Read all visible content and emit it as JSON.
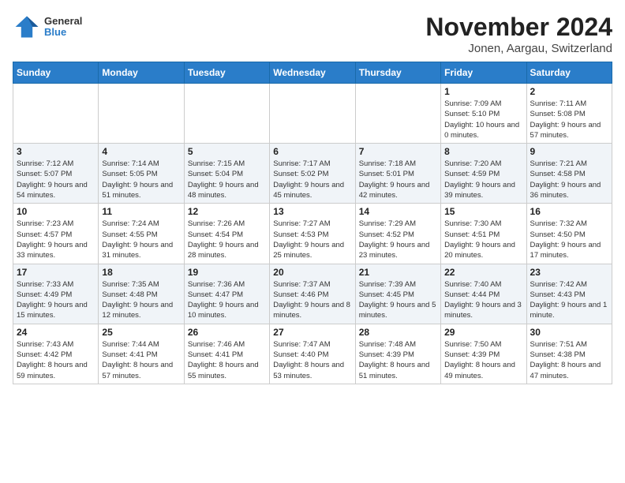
{
  "header": {
    "logo_line1": "General",
    "logo_line2": "Blue",
    "title": "November 2024",
    "subtitle": "Jonen, Aargau, Switzerland"
  },
  "days_of_week": [
    "Sunday",
    "Monday",
    "Tuesday",
    "Wednesday",
    "Thursday",
    "Friday",
    "Saturday"
  ],
  "weeks": [
    [
      {
        "day": "",
        "info": ""
      },
      {
        "day": "",
        "info": ""
      },
      {
        "day": "",
        "info": ""
      },
      {
        "day": "",
        "info": ""
      },
      {
        "day": "",
        "info": ""
      },
      {
        "day": "1",
        "info": "Sunrise: 7:09 AM\nSunset: 5:10 PM\nDaylight: 10 hours and 0 minutes."
      },
      {
        "day": "2",
        "info": "Sunrise: 7:11 AM\nSunset: 5:08 PM\nDaylight: 9 hours and 57 minutes."
      }
    ],
    [
      {
        "day": "3",
        "info": "Sunrise: 7:12 AM\nSunset: 5:07 PM\nDaylight: 9 hours and 54 minutes."
      },
      {
        "day": "4",
        "info": "Sunrise: 7:14 AM\nSunset: 5:05 PM\nDaylight: 9 hours and 51 minutes."
      },
      {
        "day": "5",
        "info": "Sunrise: 7:15 AM\nSunset: 5:04 PM\nDaylight: 9 hours and 48 minutes."
      },
      {
        "day": "6",
        "info": "Sunrise: 7:17 AM\nSunset: 5:02 PM\nDaylight: 9 hours and 45 minutes."
      },
      {
        "day": "7",
        "info": "Sunrise: 7:18 AM\nSunset: 5:01 PM\nDaylight: 9 hours and 42 minutes."
      },
      {
        "day": "8",
        "info": "Sunrise: 7:20 AM\nSunset: 4:59 PM\nDaylight: 9 hours and 39 minutes."
      },
      {
        "day": "9",
        "info": "Sunrise: 7:21 AM\nSunset: 4:58 PM\nDaylight: 9 hours and 36 minutes."
      }
    ],
    [
      {
        "day": "10",
        "info": "Sunrise: 7:23 AM\nSunset: 4:57 PM\nDaylight: 9 hours and 33 minutes."
      },
      {
        "day": "11",
        "info": "Sunrise: 7:24 AM\nSunset: 4:55 PM\nDaylight: 9 hours and 31 minutes."
      },
      {
        "day": "12",
        "info": "Sunrise: 7:26 AM\nSunset: 4:54 PM\nDaylight: 9 hours and 28 minutes."
      },
      {
        "day": "13",
        "info": "Sunrise: 7:27 AM\nSunset: 4:53 PM\nDaylight: 9 hours and 25 minutes."
      },
      {
        "day": "14",
        "info": "Sunrise: 7:29 AM\nSunset: 4:52 PM\nDaylight: 9 hours and 23 minutes."
      },
      {
        "day": "15",
        "info": "Sunrise: 7:30 AM\nSunset: 4:51 PM\nDaylight: 9 hours and 20 minutes."
      },
      {
        "day": "16",
        "info": "Sunrise: 7:32 AM\nSunset: 4:50 PM\nDaylight: 9 hours and 17 minutes."
      }
    ],
    [
      {
        "day": "17",
        "info": "Sunrise: 7:33 AM\nSunset: 4:49 PM\nDaylight: 9 hours and 15 minutes."
      },
      {
        "day": "18",
        "info": "Sunrise: 7:35 AM\nSunset: 4:48 PM\nDaylight: 9 hours and 12 minutes."
      },
      {
        "day": "19",
        "info": "Sunrise: 7:36 AM\nSunset: 4:47 PM\nDaylight: 9 hours and 10 minutes."
      },
      {
        "day": "20",
        "info": "Sunrise: 7:37 AM\nSunset: 4:46 PM\nDaylight: 9 hours and 8 minutes."
      },
      {
        "day": "21",
        "info": "Sunrise: 7:39 AM\nSunset: 4:45 PM\nDaylight: 9 hours and 5 minutes."
      },
      {
        "day": "22",
        "info": "Sunrise: 7:40 AM\nSunset: 4:44 PM\nDaylight: 9 hours and 3 minutes."
      },
      {
        "day": "23",
        "info": "Sunrise: 7:42 AM\nSunset: 4:43 PM\nDaylight: 9 hours and 1 minute."
      }
    ],
    [
      {
        "day": "24",
        "info": "Sunrise: 7:43 AM\nSunset: 4:42 PM\nDaylight: 8 hours and 59 minutes."
      },
      {
        "day": "25",
        "info": "Sunrise: 7:44 AM\nSunset: 4:41 PM\nDaylight: 8 hours and 57 minutes."
      },
      {
        "day": "26",
        "info": "Sunrise: 7:46 AM\nSunset: 4:41 PM\nDaylight: 8 hours and 55 minutes."
      },
      {
        "day": "27",
        "info": "Sunrise: 7:47 AM\nSunset: 4:40 PM\nDaylight: 8 hours and 53 minutes."
      },
      {
        "day": "28",
        "info": "Sunrise: 7:48 AM\nSunset: 4:39 PM\nDaylight: 8 hours and 51 minutes."
      },
      {
        "day": "29",
        "info": "Sunrise: 7:50 AM\nSunset: 4:39 PM\nDaylight: 8 hours and 49 minutes."
      },
      {
        "day": "30",
        "info": "Sunrise: 7:51 AM\nSunset: 4:38 PM\nDaylight: 8 hours and 47 minutes."
      }
    ]
  ]
}
